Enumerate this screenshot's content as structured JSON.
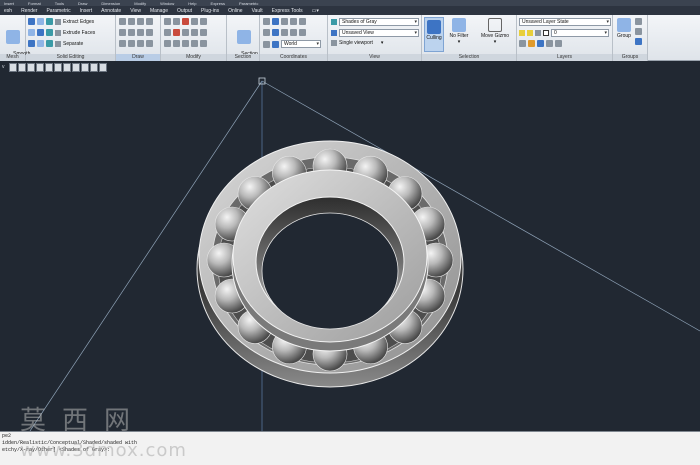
{
  "menubar": {
    "items": [
      "Insert",
      "Format",
      "Tools",
      "Draw",
      "Dimension",
      "Modify",
      "Window",
      "Help",
      "Express",
      "Parametric"
    ]
  },
  "ribbon_tabs": [
    {
      "label": "esh",
      "active": false
    },
    {
      "label": "Render",
      "active": false
    },
    {
      "label": "Parametric",
      "active": false
    },
    {
      "label": "Insert",
      "active": false
    },
    {
      "label": "Annotate",
      "active": false
    },
    {
      "label": "View",
      "active": false
    },
    {
      "label": "Manage",
      "active": false
    },
    {
      "label": "Output",
      "active": false
    },
    {
      "label": "Plug-ins",
      "active": false
    },
    {
      "label": "Online",
      "active": false
    },
    {
      "label": "Vault",
      "active": false
    },
    {
      "label": "Express Tools",
      "active": false
    },
    {
      "label": "▭▾",
      "active": false
    }
  ],
  "ribbon": {
    "mesh": {
      "smooth_object": "Smooth\nObject",
      "title": "Mesh"
    },
    "solid_editing": {
      "extract_edges": "Extract Edges",
      "extrude_faces": "Extrude Faces",
      "separate": "Separate",
      "title": "Solid Editing"
    },
    "draw": {
      "title": "Draw"
    },
    "modify": {
      "title": "Modify"
    },
    "section": {
      "section_plane": "Section\nPlane",
      "title": "Section"
    },
    "coordinates": {
      "world": "World",
      "title": "Coordinates"
    },
    "view": {
      "visual_style": "Shades of Gray",
      "saved_view": "Unsaved View",
      "viewport_config": "Single viewport",
      "title": "View"
    },
    "selection": {
      "culling": "Culling",
      "no_filter": "No Filter",
      "move_gizmo": "Move Gizmo",
      "title": "Selection"
    },
    "layers": {
      "layer_state": "Unsaved Layer State",
      "current_layer": "0",
      "title": "Layers"
    },
    "groups": {
      "group": "Group",
      "title": "Groups"
    }
  },
  "viewport": {
    "label": "v",
    "bearing": {
      "ball_count": 16
    }
  },
  "cmdline": {
    "lines": [
      "pe2",
      "idden/Realistic/Conceptual/Shaded/shaded with",
      "etchy/X-ray/Other] <Shades of Gray>: "
    ]
  },
  "watermark": {
    "cn": "莫西网",
    "url": "www.3dmox.com"
  },
  "colors": {
    "viewport_bg": "#212832",
    "ribbon_bg": "#e5e9ee",
    "highlight": "#b9cde6"
  }
}
